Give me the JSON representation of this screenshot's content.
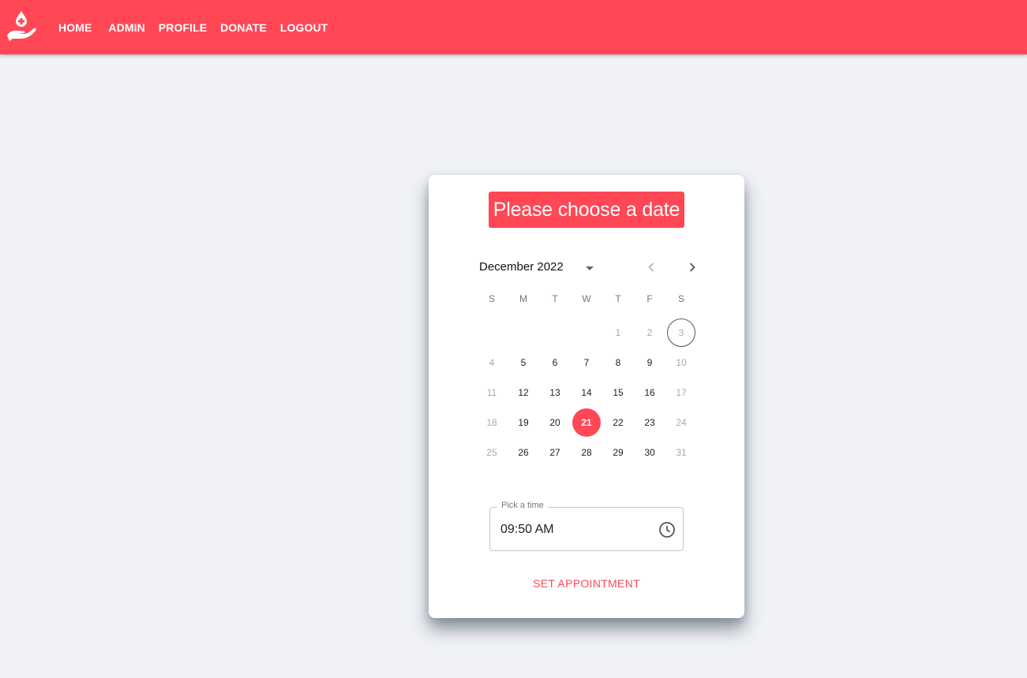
{
  "navbar": {
    "logo_icon": "hand-holding-blood-drop-icon",
    "links": [
      {
        "label": "HOME"
      },
      {
        "label": "ADMIN"
      },
      {
        "label": "PROFILE"
      },
      {
        "label": "DONATE"
      },
      {
        "label": "LOGOUT"
      }
    ],
    "background_color": "#ff4756"
  },
  "card": {
    "title": "Please choose a date",
    "calendar": {
      "month_label": "December 2022",
      "dropdown_icon": "arrow-drop-down-icon",
      "prev_icon": "chevron-left-icon",
      "next_icon": "chevron-right-icon",
      "weekdays": [
        "S",
        "M",
        "T",
        "W",
        "T",
        "F",
        "S"
      ],
      "days": [
        {
          "label": "",
          "state": "empty"
        },
        {
          "label": "",
          "state": "empty"
        },
        {
          "label": "",
          "state": "empty"
        },
        {
          "label": "",
          "state": "empty"
        },
        {
          "label": "1",
          "state": "disabled"
        },
        {
          "label": "2",
          "state": "disabled"
        },
        {
          "label": "3",
          "state": "disabled today"
        },
        {
          "label": "4",
          "state": "disabled"
        },
        {
          "label": "5",
          "state": ""
        },
        {
          "label": "6",
          "state": ""
        },
        {
          "label": "7",
          "state": ""
        },
        {
          "label": "8",
          "state": ""
        },
        {
          "label": "9",
          "state": ""
        },
        {
          "label": "10",
          "state": "disabled"
        },
        {
          "label": "11",
          "state": "disabled"
        },
        {
          "label": "12",
          "state": ""
        },
        {
          "label": "13",
          "state": ""
        },
        {
          "label": "14",
          "state": ""
        },
        {
          "label": "15",
          "state": ""
        },
        {
          "label": "16",
          "state": ""
        },
        {
          "label": "17",
          "state": "disabled"
        },
        {
          "label": "18",
          "state": "disabled"
        },
        {
          "label": "19",
          "state": ""
        },
        {
          "label": "20",
          "state": ""
        },
        {
          "label": "21",
          "state": "selected"
        },
        {
          "label": "22",
          "state": ""
        },
        {
          "label": "23",
          "state": ""
        },
        {
          "label": "24",
          "state": "disabled"
        },
        {
          "label": "25",
          "state": "disabled"
        },
        {
          "label": "26",
          "state": ""
        },
        {
          "label": "27",
          "state": ""
        },
        {
          "label": "28",
          "state": ""
        },
        {
          "label": "29",
          "state": ""
        },
        {
          "label": "30",
          "state": ""
        },
        {
          "label": "31",
          "state": "disabled"
        }
      ],
      "selected_day": "21",
      "today": "3"
    },
    "time_field": {
      "label": "Pick a time",
      "value": "09:50 AM",
      "icon": "clock-icon"
    },
    "submit_label": "SET APPOINTMENT"
  }
}
